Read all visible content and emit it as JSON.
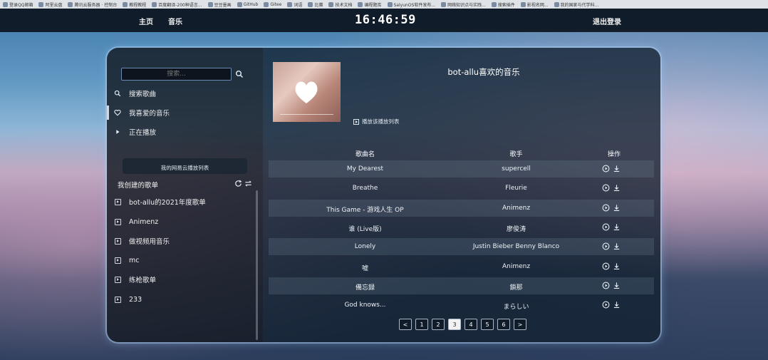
{
  "browser": {
    "bookmarks": [
      "登录QQ邮箱",
      "阿里云盘",
      "腾讯云服务器 · 控制台",
      "教程教程",
      "百度翻译-200种语言...",
      "豆豆墨画",
      "GitHub",
      "Gitee",
      "词语",
      "比赛",
      "技术文档",
      "编程题库",
      "SalyunOS软件发布...",
      "网络知识点与实践...",
      "搜索插件",
      "影视名网...",
      "我的国家与代学科..."
    ]
  },
  "nav": {
    "home": "主页",
    "music": "音乐",
    "clock": "16:46:59",
    "logout": "退出登录"
  },
  "sidebar": {
    "search_placeholder": "搜索...",
    "menu": [
      {
        "label": "搜索歌曲",
        "icon": "search-icon"
      },
      {
        "label": "我喜爱的音乐",
        "icon": "heart-icon",
        "active": true
      },
      {
        "label": "正在播放",
        "icon": "play-icon"
      }
    ],
    "netease_button": "我的网易云播放列表",
    "my_playlists_label": "我创建的歌单",
    "playlists": [
      "bot-allu的2021年度歌单",
      "Animenz",
      "做视频用音乐",
      "mc",
      "练枪歌单",
      "233"
    ]
  },
  "main": {
    "playlist_title": "bot-allu喜欢的音乐",
    "play_all": "播放该播放列表",
    "columns": {
      "title": "歌曲名",
      "artist": "歌手",
      "ops": "操作"
    },
    "songs": [
      {
        "title": "My Dearest",
        "artist": "supercell"
      },
      {
        "title": "Breathe",
        "artist": "Fleurie"
      },
      {
        "title": "This Game - 游戏人生 OP",
        "artist": "Animenz"
      },
      {
        "title": "谁 (Live版)",
        "artist": "廖俊涛"
      },
      {
        "title": "Lonely",
        "artist": "Justin Bieber Benny Blanco"
      },
      {
        "title": "嘘",
        "artist": "Animenz"
      },
      {
        "title": "備忘録",
        "artist": "鎖那"
      },
      {
        "title": "God knows...",
        "artist": "まらしい"
      }
    ],
    "pagination": {
      "prev": "<",
      "pages": [
        "1",
        "2",
        "3",
        "4",
        "5",
        "6"
      ],
      "current": "3",
      "next": ">"
    }
  },
  "colors": {
    "panel_border": "#b4d2f0",
    "accent": "#f2f2f2",
    "nav_bg": "#0c141e"
  }
}
